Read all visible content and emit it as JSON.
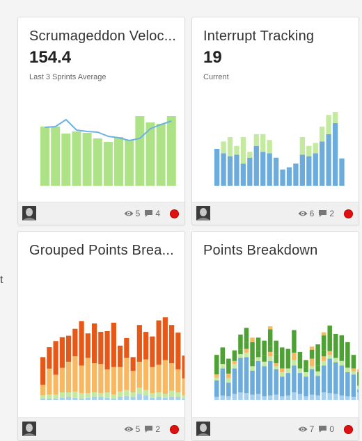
{
  "stray_text": "t",
  "colors": {
    "green": "#ade386",
    "lightgreen": "#c3ea9e",
    "blue": "#6cacdc",
    "line": "#6cb1e2",
    "dark_orange": "#e65817",
    "light_orange": "#f8b861",
    "dark_green": "#4ea233",
    "light_blue": "#a7d0ef",
    "status_red": "#dd1111"
  },
  "cards": [
    {
      "title": "Scrumageddon Veloc...",
      "metric": "154.4",
      "subtitle": "Last 3 Sprints Average",
      "views": "5",
      "comments": "4",
      "avatar": "user-avatar",
      "status": "red",
      "chart_data": {
        "type": "bar",
        "series": [
          {
            "values": [
              85,
              85,
              75,
              78,
              76,
              68,
              63,
              70,
              66,
              100,
              91,
              89,
              100
            ]
          },
          {
            "values": [
              84,
              85,
              95,
              80,
              78,
              77,
              71,
              69,
              65,
              68,
              82,
              88,
              93
            ]
          }
        ]
      }
    },
    {
      "title": "Interrupt Tracking",
      "metric": "19",
      "subtitle": "Current",
      "views": "6",
      "comments": "2",
      "avatar": "user-avatar",
      "status": "red",
      "chart_data": {
        "type": "bar",
        "stacked": true,
        "series": [
          {
            "values": [
              50,
              44,
              40,
              42,
              30,
              38,
              54,
              46,
              44,
              38,
              22,
              25,
              30,
              42,
              40,
              44,
              60,
              70,
              85,
              37
            ]
          },
          {
            "values": [
              0,
              16,
              26,
              12,
              36,
              8,
              16,
              24,
              18,
              0,
              0,
              0,
              0,
              24,
              14,
              14,
              20,
              26,
              15,
              0
            ]
          }
        ]
      }
    },
    {
      "title": "Grouped Points Brea...",
      "metric": "",
      "subtitle": "",
      "views": "5",
      "comments": "2",
      "avatar": "user-avatar",
      "status": "red",
      "chart_data": {
        "type": "bar",
        "stacked": true,
        "series": [
          {
            "values": [
              2,
              2,
              2,
              3,
              4,
              3,
              2,
              3,
              4,
              4,
              3,
              2,
              4,
              5,
              4,
              8,
              6,
              3,
              4,
              3,
              4,
              4,
              2
            ]
          },
          {
            "values": [
              4,
              5,
              5,
              7,
              6,
              8,
              7,
              6,
              6,
              5,
              7,
              5,
              7,
              8,
              6,
              8,
              7,
              6,
              6,
              5,
              8,
              6,
              4
            ]
          },
          {
            "values": [
              14,
              34,
              26,
              32,
              40,
              46,
              36,
              46,
              38,
              38,
              30,
              36,
              32,
              42,
              28,
              34,
              40,
              34,
              36,
              44,
              36,
              30,
              22
            ]
          },
          {
            "values": [
              36,
              28,
              44,
              40,
              34,
              36,
              58,
              32,
              52,
              42,
              50,
              58,
              28,
              26,
              18,
              48,
              36,
              40,
              58,
              56,
              50,
              48,
              30
            ]
          }
        ]
      }
    },
    {
      "title": "Points Breakdown",
      "metric": "",
      "subtitle": "",
      "views": "7",
      "comments": "0",
      "avatar": "user-avatar",
      "status": "red",
      "chart_data": {
        "type": "bar",
        "stacked": true,
        "series": [
          {
            "values": [
              4,
              6,
              5,
              8,
              10,
              9,
              7,
              8,
              5,
              6,
              7,
              5,
              6,
              10,
              8,
              5,
              7,
              6,
              10,
              9,
              8,
              6,
              5,
              4,
              10
            ]
          },
          {
            "values": [
              22,
              36,
              18,
              34,
              46,
              48,
              32,
              44,
              40,
              46,
              34,
              26,
              30,
              36,
              28,
              26,
              34,
              26,
              36,
              46,
              42,
              40,
              32,
              30,
              4
            ]
          },
          {
            "values": [
              4,
              6,
              6,
              6,
              5,
              6,
              6,
              5,
              6,
              6,
              4,
              6,
              6,
              7,
              6,
              6,
              4,
              6,
              6,
              5,
              6,
              6,
              6,
              4,
              5
            ]
          },
          {
            "values": [
              4,
              0,
              6,
              4,
              0,
              5,
              0,
              0,
              0,
              6,
              4,
              5,
              0,
              10,
              0,
              0,
              10,
              0,
              6,
              5,
              0,
              0,
              0,
              4,
              0
            ]
          },
          {
            "values": [
              0,
              8,
              0,
              0,
              6,
              8,
              8,
              8,
              8,
              8,
              12,
              8,
              0,
              6,
              0,
              6,
              0,
              8,
              8,
              10,
              6,
              4,
              0,
              0,
              0
            ]
          },
          {
            "values": [
              26,
              14,
              20,
              14,
              20,
              20,
              24,
              18,
              20,
              22,
              18,
              20,
              26,
              24,
              22,
              10,
              12,
              28,
              20,
              24,
              26,
              30,
              34,
              18,
              18
            ]
          },
          {
            "values": [
              0,
              0,
              0,
              0,
              0,
              0,
              6,
              0,
              0,
              4,
              0,
              0,
              0,
              0,
              0,
              0,
              4,
              0,
              4,
              0,
              0,
              0,
              0,
              0,
              4
            ]
          }
        ]
      }
    }
  ]
}
